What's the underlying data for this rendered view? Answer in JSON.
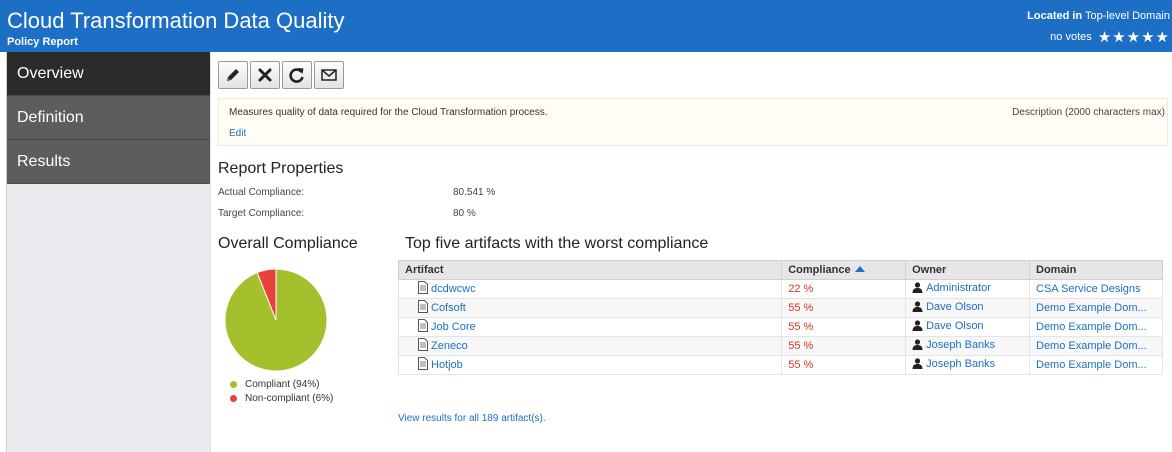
{
  "header": {
    "title": "Cloud Transformation Data Quality",
    "subtitle": "Policy Report",
    "located_label": "Located in",
    "located_value": "Top-level Domain",
    "votes": "no votes",
    "stars": "★★★★★",
    "background_color": "#1d6fc5"
  },
  "sidebar": {
    "items": [
      {
        "label": "Overview",
        "active": true
      },
      {
        "label": "Definition",
        "active": false
      },
      {
        "label": "Results",
        "active": false
      }
    ]
  },
  "toolbar": {
    "buttons": [
      "pencil-icon",
      "close-icon",
      "refresh-icon",
      "envelope-icon"
    ]
  },
  "description": {
    "text": "Measures quality of data required for the Cloud Transformation process.",
    "hint": "Description (2000 characters max)",
    "edit_label": "Edit"
  },
  "properties": {
    "title": "Report Properties",
    "actual_label": "Actual Compliance:",
    "actual_value": "80.541 %",
    "target_label": "Target Compliance:",
    "target_value": "80 %"
  },
  "overall": {
    "title": "Overall Compliance"
  },
  "chart_data": {
    "type": "pie",
    "categories": [
      "Compliant (94%)",
      "Non-compliant (6%)"
    ],
    "values": [
      94,
      6
    ],
    "colors": [
      "#a4c12d",
      "#e8403a"
    ],
    "title": "Overall Compliance",
    "legend": "bottom"
  },
  "worst": {
    "title": "Top five artifacts with the worst compliance",
    "columns": {
      "artifact": "Artifact",
      "compliance": "Compliance",
      "owner": "Owner",
      "domain": "Domain"
    },
    "rows": [
      {
        "artifact": "dcdwcwc",
        "compliance": "22 %",
        "owner": "Administrator",
        "domain": "CSA Service Designs"
      },
      {
        "artifact": "Cofsoft",
        "compliance": "55 %",
        "owner": "Dave Olson",
        "domain": "Demo Example Dom..."
      },
      {
        "artifact": "Job Core",
        "compliance": "55 %",
        "owner": "Dave Olson",
        "domain": "Demo Example Dom..."
      },
      {
        "artifact": "Zeneco",
        "compliance": "55 %",
        "owner": "Joseph Banks",
        "domain": "Demo Example Dom..."
      },
      {
        "artifact": "Hotjob",
        "compliance": "55 %",
        "owner": "Joseph Banks",
        "domain": "Demo Example Dom..."
      }
    ],
    "view_all": "View results for all 189 artifact(s)."
  },
  "colors": {
    "accent": "#1d6fc5",
    "bad": "#d9342b",
    "compliant": "#a4c12d",
    "noncompliant": "#e8403a"
  }
}
